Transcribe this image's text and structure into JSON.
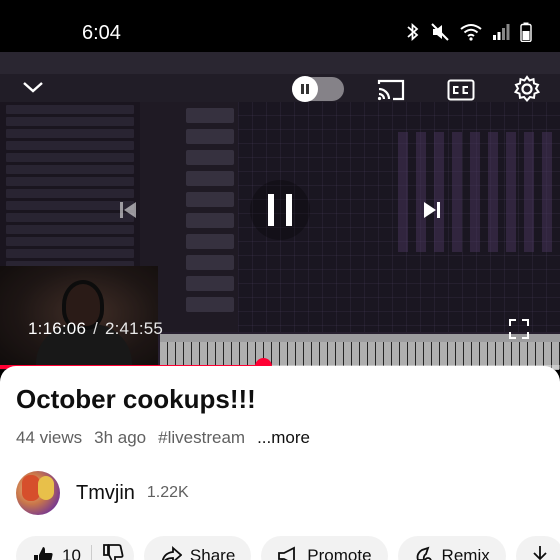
{
  "status_bar": {
    "time": "6:04",
    "icons": [
      "bluetooth-icon",
      "mute-icon",
      "wifi-icon",
      "signal-icon",
      "battery-icon"
    ]
  },
  "player": {
    "current_time": "1:16:06",
    "separator": "/",
    "duration": "2:41:55",
    "progress_fraction": 0.47,
    "accent_color": "#ff0033",
    "state": "playing"
  },
  "video": {
    "title": "October cookups!!!",
    "views": "44 views",
    "posted": "3h ago",
    "hashtag": "#livestream",
    "more_label": "...more"
  },
  "channel": {
    "name": "Tmvjin",
    "subscribers": "1.22K"
  },
  "actions": {
    "like_count": "10",
    "share_label": "Share",
    "promote_label": "Promote",
    "remix_label": "Remix"
  }
}
